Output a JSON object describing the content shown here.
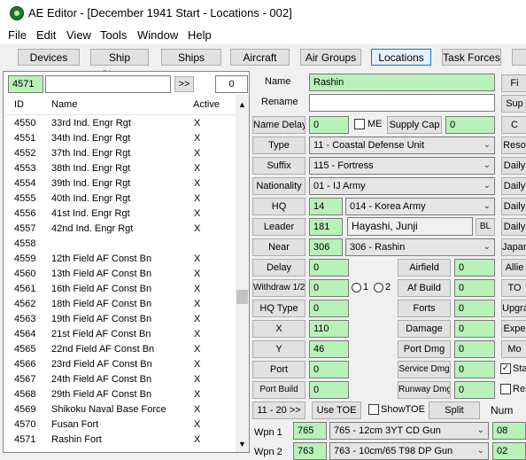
{
  "window": {
    "title": "AE Editor - [December 1941 Start - Locations - 002]"
  },
  "menu": [
    "File",
    "Edit",
    "View",
    "Tools",
    "Window",
    "Help"
  ],
  "toolbar": [
    "Devices",
    "Ship Classes",
    "Ships",
    "Aircraft",
    "Air Groups",
    "Locations",
    "Task Forces"
  ],
  "search": {
    "id_value": "4571",
    "text_value": "",
    "go_label": ">>",
    "count": "0"
  },
  "list": {
    "headers": {
      "id": "ID",
      "name": "Name",
      "active": "Active"
    },
    "rows": [
      {
        "id": "4550",
        "name": "33rd Ind. Engr Rgt",
        "active": "X"
      },
      {
        "id": "4551",
        "name": "34th Ind. Engr Rgt",
        "active": "X"
      },
      {
        "id": "4552",
        "name": "37th Ind. Engr Rgt",
        "active": "X"
      },
      {
        "id": "4553",
        "name": "38th Ind. Engr Rgt",
        "active": "X"
      },
      {
        "id": "4554",
        "name": "39th Ind. Engr Rgt",
        "active": "X"
      },
      {
        "id": "4555",
        "name": "40th Ind. Engr Rgt",
        "active": "X"
      },
      {
        "id": "4556",
        "name": "41st Ind. Engr Rgt",
        "active": "X"
      },
      {
        "id": "4557",
        "name": "42nd Ind. Engr Rgt",
        "active": "X"
      },
      {
        "id": "4558",
        "name": "",
        "active": ""
      },
      {
        "id": "4559",
        "name": "12th Field AF Const Bn",
        "active": "X"
      },
      {
        "id": "4560",
        "name": "13th Field AF Const Bn",
        "active": "X"
      },
      {
        "id": "4561",
        "name": "16th Field AF Const Bn",
        "active": "X"
      },
      {
        "id": "4562",
        "name": "18th Field AF Const Bn",
        "active": "X"
      },
      {
        "id": "4563",
        "name": "19th Field AF Const Bn",
        "active": "X"
      },
      {
        "id": "4564",
        "name": "21st Field AF Const Bn",
        "active": "X"
      },
      {
        "id": "4565",
        "name": "22nd Field AF Const Bn",
        "active": "X"
      },
      {
        "id": "4566",
        "name": "23rd Field AF Const Bn",
        "active": "X"
      },
      {
        "id": "4567",
        "name": "24th Field AF Const Bn",
        "active": "X"
      },
      {
        "id": "4568",
        "name": "29th Field AF Const Bn",
        "active": "X"
      },
      {
        "id": "4569",
        "name": "Shikoku Naval Base Force",
        "active": "X"
      },
      {
        "id": "4570",
        "name": "Fusan Fort",
        "active": "X"
      },
      {
        "id": "4571",
        "name": "Rashin Fort",
        "active": "X"
      }
    ]
  },
  "detail": {
    "name_label": "Name",
    "name_value": "Rashin",
    "rename_label": "Rename",
    "rename_value": "",
    "name_delay_label": "Name Delay",
    "name_delay_value": "0",
    "me_label": "ME",
    "supply_cap_label": "Supply Cap",
    "supply_cap_value": "0",
    "type_label": "Type",
    "type_value": "11 - Coastal Defense Unit",
    "suffix_label": "Suffix",
    "suffix_value": "115 - Fortress",
    "nationality_label": "Nationality",
    "nationality_value": "01 - IJ Army",
    "hq_label": "HQ",
    "hq_id": "14",
    "hq_value": "014 - Korea Army",
    "leader_label": "Leader",
    "leader_id": "181",
    "leader_value": "Hayashi, Junji",
    "bl_label": "BL",
    "near_label": "Near",
    "near_id": "306",
    "near_value": "306 - Rashin",
    "delay_label": "Delay",
    "delay_value": "0",
    "airfield_label": "Airfield",
    "airfield_value": "0",
    "withdraw_label": "Withdraw 1/2",
    "withdraw_value": "0",
    "radio1_label": "1",
    "radio2_label": "2",
    "afbuild_label": "Af Build",
    "afbuild_value": "0",
    "hqtype_label": "HQ Type",
    "hqtype_value": "0",
    "forts_label": "Forts",
    "forts_value": "0",
    "x_label": "X",
    "x_value": "110",
    "damage_label": "Damage",
    "damage_value": "0",
    "y_label": "Y",
    "y_value": "46",
    "portdmg_label": "Port Dmg",
    "portdmg_value": "0",
    "port_label": "Port",
    "port_value": "0",
    "servicedmg_label": "Service Dmg",
    "servicedmg_value": "0",
    "portbuild_label": "Port Build",
    "portbuild_value": "0",
    "runwaydmg_label": "Runway Dmg",
    "runwaydmg_value": "0",
    "range_label": "11 - 20 >>",
    "usetoe_label": "Use TOE",
    "showtoe_label": "ShowTOE",
    "split_label": "Split",
    "num_label": "Num",
    "wpn1_label": "Wpn 1",
    "wpn1_id": "765",
    "wpn1_value": "765 - 12cm 3YT CD Gun",
    "wpn1_num": "08",
    "wpn2_label": "Wpn 2",
    "wpn2_id": "763",
    "wpn2_value": "763 - 10cm/65 T98 DP Gun",
    "wpn2_num": "02"
  },
  "right_edge": [
    "Fi",
    "Sup",
    "C",
    "Reso",
    "Daily",
    "Daily",
    "Daily",
    "Daily",
    "Japan",
    "Allie",
    "TO",
    "Upgra",
    "Expe",
    "Mo",
    "Stat",
    "Rese"
  ],
  "colors": {
    "field_green": "#b9f2b9",
    "active_tab_border": "#0078d7"
  }
}
